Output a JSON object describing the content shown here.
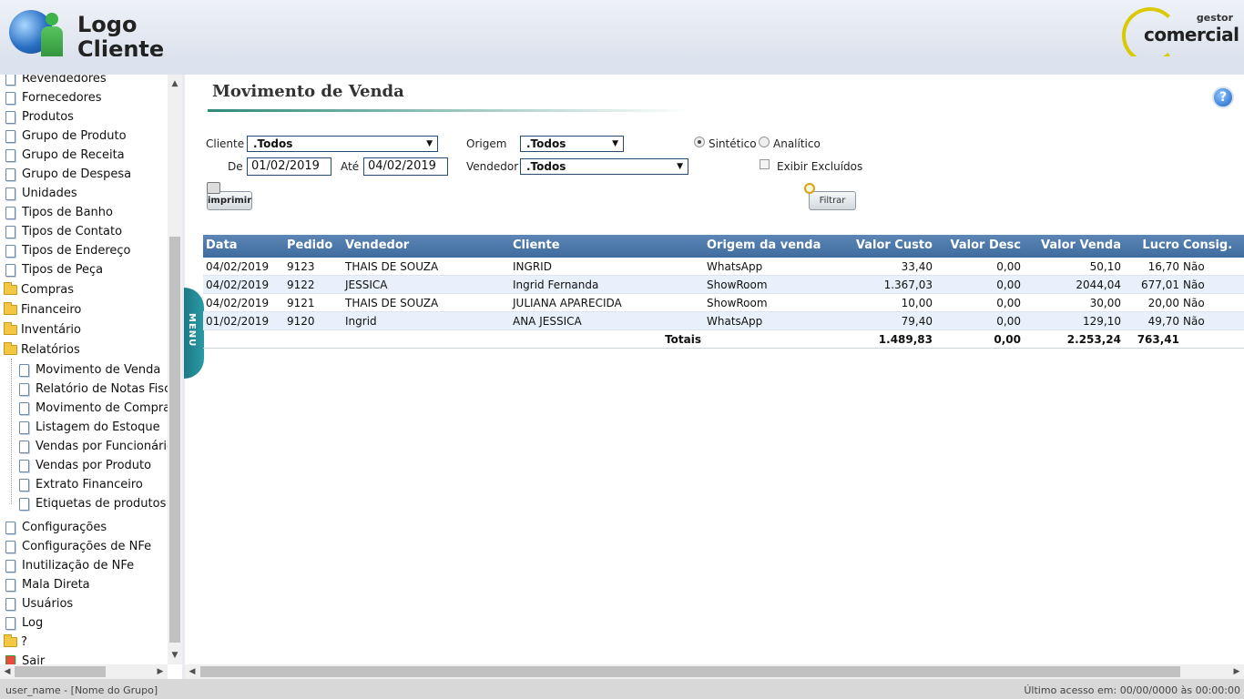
{
  "header": {
    "logo_line1": "Logo",
    "logo_line2": "Cliente",
    "brand_small": "gestor",
    "brand_big": "comercial"
  },
  "sidebar": {
    "items": [
      {
        "label": "Revendedores",
        "icon": "document-icon"
      },
      {
        "label": "Fornecedores",
        "icon": "document-icon"
      },
      {
        "label": "Produtos",
        "icon": "document-icon"
      },
      {
        "label": "Grupo de Produto",
        "icon": "document-icon"
      },
      {
        "label": "Grupo de Receita",
        "icon": "document-icon"
      },
      {
        "label": "Grupo de Despesa",
        "icon": "document-icon"
      },
      {
        "label": "Unidades",
        "icon": "document-icon"
      },
      {
        "label": "Tipos de Banho",
        "icon": "document-icon"
      },
      {
        "label": "Tipos de Contato",
        "icon": "document-icon"
      },
      {
        "label": "Tipos de Endereço",
        "icon": "document-icon"
      },
      {
        "label": "Tipos de Peça",
        "icon": "document-icon"
      },
      {
        "label": "Compras",
        "icon": "folder-icon"
      },
      {
        "label": "Financeiro",
        "icon": "folder-icon"
      },
      {
        "label": "Inventário",
        "icon": "folder-icon"
      },
      {
        "label": "Relatórios",
        "icon": "folder-open-icon"
      }
    ],
    "report_items": [
      "Movimento de Venda",
      "Relatório de Notas Fiscais",
      "Movimento de Compra",
      "Listagem do Estoque",
      "Vendas por Funcionário",
      "Vendas por Produto",
      "Extrato Financeiro",
      "Etiquetas de produtos"
    ],
    "bottom_items": [
      {
        "label": "Configurações",
        "icon": "document-icon"
      },
      {
        "label": "Configurações de NFe",
        "icon": "document-icon"
      },
      {
        "label": "Inutilização de NFe",
        "icon": "document-icon"
      },
      {
        "label": "Mala Direta",
        "icon": "document-icon"
      },
      {
        "label": "Usuários",
        "icon": "document-icon"
      },
      {
        "label": "Log",
        "icon": "document-icon"
      },
      {
        "label": "?",
        "icon": "folder-icon"
      },
      {
        "label": "Sair",
        "icon": "exit-icon"
      }
    ],
    "menu_tab": "MENU"
  },
  "page": {
    "title": "Movimento de Venda",
    "help": "?"
  },
  "filters": {
    "cliente_label": "Cliente",
    "cliente_value": ".Todos",
    "origem_label": "Origem",
    "origem_value": ".Todos",
    "de_label": "De",
    "de_value": "01/02/2019",
    "ate_label": "Até",
    "ate_value": "04/02/2019",
    "vendedor_label": "Vendedor",
    "vendedor_value": ".Todos",
    "sintetico_label": "Sintético",
    "sintetico_checked": true,
    "analitico_label": "Analítico",
    "analitico_checked": false,
    "exibir_excluidos_label": "Exibir Excluídos",
    "exibir_excluidos_checked": false,
    "print_label": "imprimir",
    "filter_label": "Filtrar"
  },
  "table": {
    "columns": [
      "Data",
      "Pedido",
      "Vendedor",
      "Cliente",
      "Origem da venda",
      "Valor Custo",
      "Valor Desc",
      "Valor Venda",
      "Lucro",
      "Consig."
    ],
    "rows": [
      [
        "04/02/2019",
        "9123",
        "THAIS DE SOUZA",
        "INGRID",
        "WhatsApp",
        "33,40",
        "0,00",
        "50,10",
        "16,70",
        "Não"
      ],
      [
        "04/02/2019",
        "9122",
        "JESSICA",
        "Ingrid Fernanda",
        "ShowRoom",
        "1.367,03",
        "0,00",
        "2044,04",
        "677,01",
        "Não"
      ],
      [
        "04/02/2019",
        "9121",
        "THAIS DE SOUZA",
        "JULIANA APARECIDA",
        "ShowRoom",
        "10,00",
        "0,00",
        "30,00",
        "20,00",
        "Não"
      ],
      [
        "01/02/2019",
        "9120",
        "Ingrid",
        "ANA JESSICA",
        "WhatsApp",
        "79,40",
        "0,00",
        "129,10",
        "49,70",
        "Não"
      ]
    ],
    "totals": {
      "label": "Totais",
      "valor_custo": "1.489,83",
      "valor_desc": "0,00",
      "valor_venda": "2.253,24",
      "lucro": "763,41"
    }
  },
  "status": {
    "user": "user_name - [Nome do Grupo]",
    "last_access": "Último acesso em: 00/00/0000  às 00:00:00"
  }
}
